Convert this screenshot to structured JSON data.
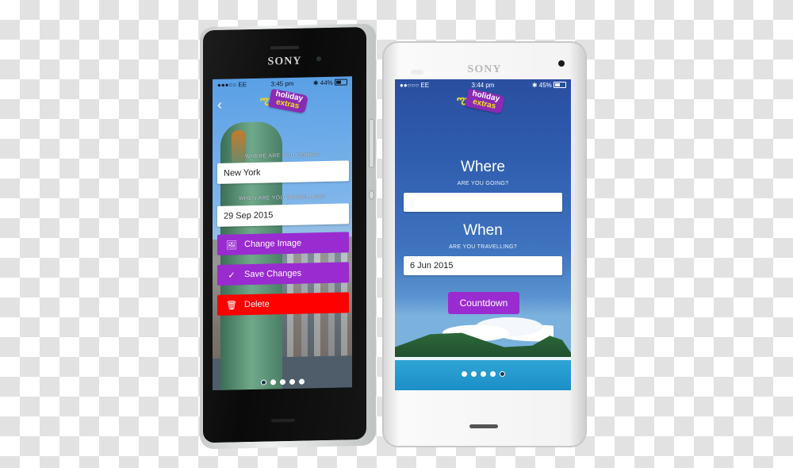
{
  "phones": [
    {
      "brand": "SONY",
      "status": {
        "carrier": "●●●○○ EE",
        "wifi": "wifi-icon",
        "time": "3:45 pm",
        "bluetooth": "✱",
        "battery": "44%",
        "battery_level": 0.44
      },
      "logo": {
        "line1": "holiday",
        "line2": "extras"
      },
      "back_icon": "‹",
      "where_caption": "WHERE ARE YOU GOING?",
      "where_value": "New York",
      "when_caption": "WHEN ARE YOU TRAVELLING?",
      "when_value": "29 Sep 2015",
      "actions": [
        {
          "icon": "🖼",
          "label": "Change Image",
          "color": "#9a2bd0"
        },
        {
          "icon": "✓",
          "label": "Save Changes",
          "color": "#9a2bd0"
        },
        {
          "icon": "🗑",
          "label": "Delete",
          "color": "#ff0000"
        }
      ],
      "page_dots": {
        "count": 5,
        "active": 1
      }
    },
    {
      "brand": "SONY",
      "status": {
        "carrier": "●●○○○ EE",
        "wifi": "wifi-icon",
        "time": "3:44 pm",
        "bluetooth": "✱",
        "battery": "45%",
        "battery_level": 0.45
      },
      "logo": {
        "line1": "holiday",
        "line2": "extras"
      },
      "where_title": "Where",
      "where_caption": "ARE YOU GOING?",
      "where_value": "",
      "when_title": "When",
      "when_caption": "ARE YOU TRAVELLING?",
      "when_value": "6 Jun 2015",
      "countdown_label": "Countdown",
      "page_dots": {
        "count": 5,
        "active": 5
      }
    }
  ],
  "colors": {
    "brand_purple": "#9a2bd0",
    "delete_red": "#ff0000",
    "screen_blue": "#2a4ea0"
  }
}
